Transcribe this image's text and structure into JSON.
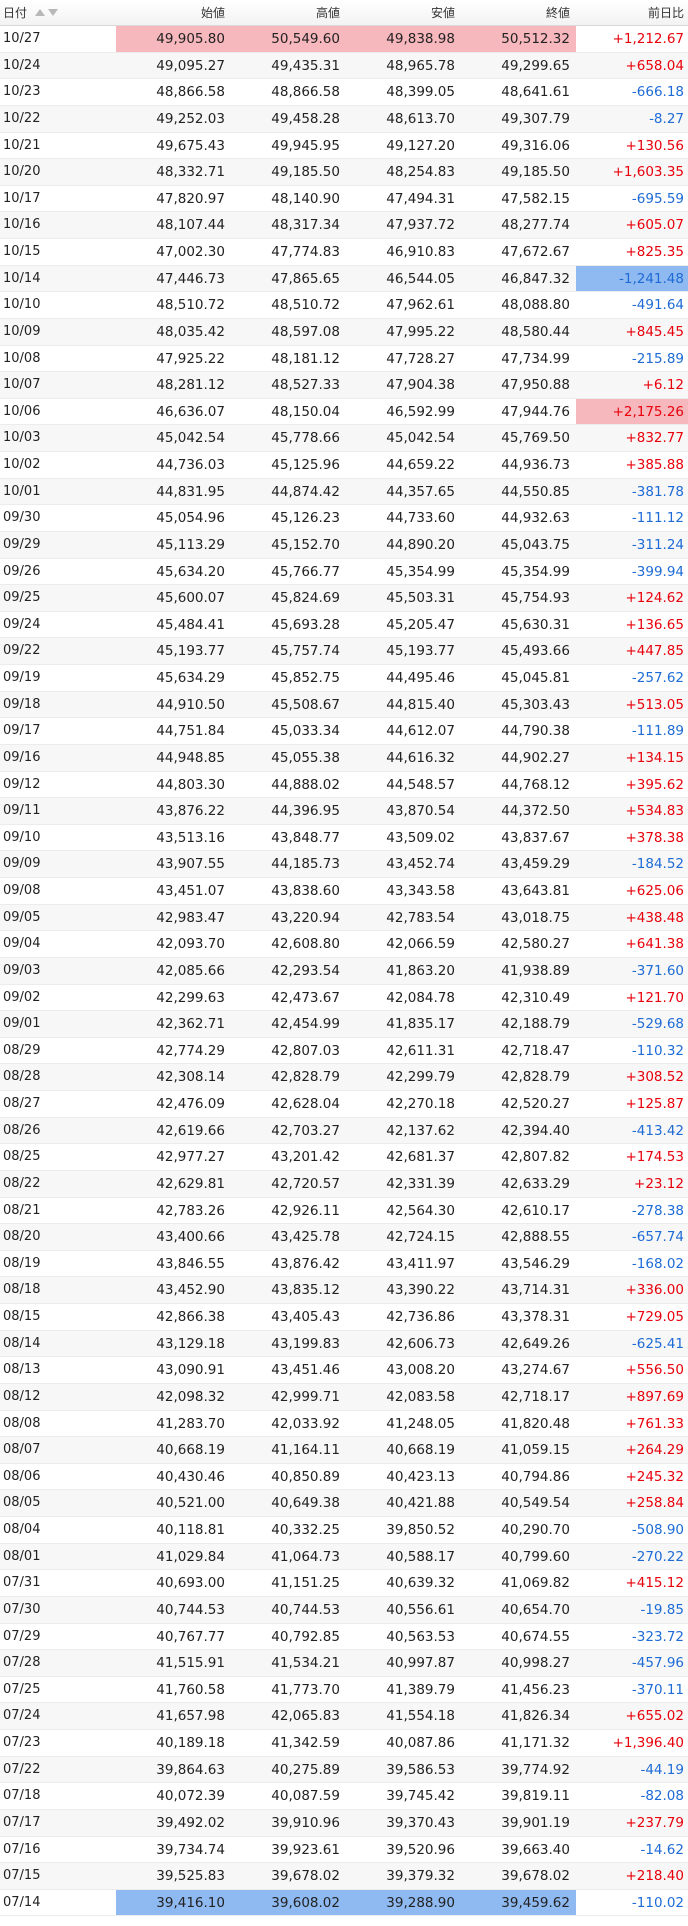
{
  "headers": {
    "date": "日付",
    "open": "始値",
    "high": "高値",
    "low": "安値",
    "close": "終値",
    "change": "前日比"
  },
  "colors": {
    "up": "#e8000b",
    "down": "#1e6bd6",
    "highlight_high": "#f6b7bd",
    "highlight_low": "#8fb9f1"
  },
  "rows": [
    {
      "date": "10/27",
      "open": "49,905.80",
      "high": "50,549.60",
      "low": "49,838.98",
      "close": "50,512.32",
      "change": "+1,212.67",
      "dir": "pos",
      "hl": [
        "open",
        "high",
        "low",
        "close"
      ],
      "hlc": "red"
    },
    {
      "date": "10/24",
      "open": "49,095.27",
      "high": "49,435.31",
      "low": "48,965.78",
      "close": "49,299.65",
      "change": "+658.04",
      "dir": "pos"
    },
    {
      "date": "10/23",
      "open": "48,866.58",
      "high": "48,866.58",
      "low": "48,399.05",
      "close": "48,641.61",
      "change": "-666.18",
      "dir": "neg"
    },
    {
      "date": "10/22",
      "open": "49,252.03",
      "high": "49,458.28",
      "low": "48,613.70",
      "close": "49,307.79",
      "change": "-8.27",
      "dir": "neg"
    },
    {
      "date": "10/21",
      "open": "49,675.43",
      "high": "49,945.95",
      "low": "49,127.20",
      "close": "49,316.06",
      "change": "+130.56",
      "dir": "pos"
    },
    {
      "date": "10/20",
      "open": "48,332.71",
      "high": "49,185.50",
      "low": "48,254.83",
      "close": "49,185.50",
      "change": "+1,603.35",
      "dir": "pos"
    },
    {
      "date": "10/17",
      "open": "47,820.97",
      "high": "48,140.90",
      "low": "47,494.31",
      "close": "47,582.15",
      "change": "-695.59",
      "dir": "neg"
    },
    {
      "date": "10/16",
      "open": "48,107.44",
      "high": "48,317.34",
      "low": "47,937.72",
      "close": "48,277.74",
      "change": "+605.07",
      "dir": "pos"
    },
    {
      "date": "10/15",
      "open": "47,002.30",
      "high": "47,774.83",
      "low": "46,910.83",
      "close": "47,672.67",
      "change": "+825.35",
      "dir": "pos"
    },
    {
      "date": "10/14",
      "open": "47,446.73",
      "high": "47,865.65",
      "low": "46,544.05",
      "close": "46,847.32",
      "change": "-1,241.48",
      "dir": "neg",
      "hl": [
        "change"
      ],
      "hlc": "blue"
    },
    {
      "date": "10/10",
      "open": "48,510.72",
      "high": "48,510.72",
      "low": "47,962.61",
      "close": "48,088.80",
      "change": "-491.64",
      "dir": "neg"
    },
    {
      "date": "10/09",
      "open": "48,035.42",
      "high": "48,597.08",
      "low": "47,995.22",
      "close": "48,580.44",
      "change": "+845.45",
      "dir": "pos"
    },
    {
      "date": "10/08",
      "open": "47,925.22",
      "high": "48,181.12",
      "low": "47,728.27",
      "close": "47,734.99",
      "change": "-215.89",
      "dir": "neg"
    },
    {
      "date": "10/07",
      "open": "48,281.12",
      "high": "48,527.33",
      "low": "47,904.38",
      "close": "47,950.88",
      "change": "+6.12",
      "dir": "pos"
    },
    {
      "date": "10/06",
      "open": "46,636.07",
      "high": "48,150.04",
      "low": "46,592.99",
      "close": "47,944.76",
      "change": "+2,175.26",
      "dir": "pos",
      "hl": [
        "change"
      ],
      "hlc": "red"
    },
    {
      "date": "10/03",
      "open": "45,042.54",
      "high": "45,778.66",
      "low": "45,042.54",
      "close": "45,769.50",
      "change": "+832.77",
      "dir": "pos"
    },
    {
      "date": "10/02",
      "open": "44,736.03",
      "high": "45,125.96",
      "low": "44,659.22",
      "close": "44,936.73",
      "change": "+385.88",
      "dir": "pos"
    },
    {
      "date": "10/01",
      "open": "44,831.95",
      "high": "44,874.42",
      "low": "44,357.65",
      "close": "44,550.85",
      "change": "-381.78",
      "dir": "neg"
    },
    {
      "date": "09/30",
      "open": "45,054.96",
      "high": "45,126.23",
      "low": "44,733.60",
      "close": "44,932.63",
      "change": "-111.12",
      "dir": "neg"
    },
    {
      "date": "09/29",
      "open": "45,113.29",
      "high": "45,152.70",
      "low": "44,890.20",
      "close": "45,043.75",
      "change": "-311.24",
      "dir": "neg"
    },
    {
      "date": "09/26",
      "open": "45,634.20",
      "high": "45,766.77",
      "low": "45,354.99",
      "close": "45,354.99",
      "change": "-399.94",
      "dir": "neg"
    },
    {
      "date": "09/25",
      "open": "45,600.07",
      "high": "45,824.69",
      "low": "45,503.31",
      "close": "45,754.93",
      "change": "+124.62",
      "dir": "pos"
    },
    {
      "date": "09/24",
      "open": "45,484.41",
      "high": "45,693.28",
      "low": "45,205.47",
      "close": "45,630.31",
      "change": "+136.65",
      "dir": "pos"
    },
    {
      "date": "09/22",
      "open": "45,193.77",
      "high": "45,757.74",
      "low": "45,193.77",
      "close": "45,493.66",
      "change": "+447.85",
      "dir": "pos"
    },
    {
      "date": "09/19",
      "open": "45,634.29",
      "high": "45,852.75",
      "low": "44,495.46",
      "close": "45,045.81",
      "change": "-257.62",
      "dir": "neg"
    },
    {
      "date": "09/18",
      "open": "44,910.50",
      "high": "45,508.67",
      "low": "44,815.40",
      "close": "45,303.43",
      "change": "+513.05",
      "dir": "pos"
    },
    {
      "date": "09/17",
      "open": "44,751.84",
      "high": "45,033.34",
      "low": "44,612.07",
      "close": "44,790.38",
      "change": "-111.89",
      "dir": "neg"
    },
    {
      "date": "09/16",
      "open": "44,948.85",
      "high": "45,055.38",
      "low": "44,616.32",
      "close": "44,902.27",
      "change": "+134.15",
      "dir": "pos"
    },
    {
      "date": "09/12",
      "open": "44,803.30",
      "high": "44,888.02",
      "low": "44,548.57",
      "close": "44,768.12",
      "change": "+395.62",
      "dir": "pos"
    },
    {
      "date": "09/11",
      "open": "43,876.22",
      "high": "44,396.95",
      "low": "43,870.54",
      "close": "44,372.50",
      "change": "+534.83",
      "dir": "pos"
    },
    {
      "date": "09/10",
      "open": "43,513.16",
      "high": "43,848.77",
      "low": "43,509.02",
      "close": "43,837.67",
      "change": "+378.38",
      "dir": "pos"
    },
    {
      "date": "09/09",
      "open": "43,907.55",
      "high": "44,185.73",
      "low": "43,452.74",
      "close": "43,459.29",
      "change": "-184.52",
      "dir": "neg"
    },
    {
      "date": "09/08",
      "open": "43,451.07",
      "high": "43,838.60",
      "low": "43,343.58",
      "close": "43,643.81",
      "change": "+625.06",
      "dir": "pos"
    },
    {
      "date": "09/05",
      "open": "42,983.47",
      "high": "43,220.94",
      "low": "42,783.54",
      "close": "43,018.75",
      "change": "+438.48",
      "dir": "pos"
    },
    {
      "date": "09/04",
      "open": "42,093.70",
      "high": "42,608.80",
      "low": "42,066.59",
      "close": "42,580.27",
      "change": "+641.38",
      "dir": "pos"
    },
    {
      "date": "09/03",
      "open": "42,085.66",
      "high": "42,293.54",
      "low": "41,863.20",
      "close": "41,938.89",
      "change": "-371.60",
      "dir": "neg"
    },
    {
      "date": "09/02",
      "open": "42,299.63",
      "high": "42,473.67",
      "low": "42,084.78",
      "close": "42,310.49",
      "change": "+121.70",
      "dir": "pos"
    },
    {
      "date": "09/01",
      "open": "42,362.71",
      "high": "42,454.99",
      "low": "41,835.17",
      "close": "42,188.79",
      "change": "-529.68",
      "dir": "neg"
    },
    {
      "date": "08/29",
      "open": "42,774.29",
      "high": "42,807.03",
      "low": "42,611.31",
      "close": "42,718.47",
      "change": "-110.32",
      "dir": "neg"
    },
    {
      "date": "08/28",
      "open": "42,308.14",
      "high": "42,828.79",
      "low": "42,299.79",
      "close": "42,828.79",
      "change": "+308.52",
      "dir": "pos"
    },
    {
      "date": "08/27",
      "open": "42,476.09",
      "high": "42,628.04",
      "low": "42,270.18",
      "close": "42,520.27",
      "change": "+125.87",
      "dir": "pos"
    },
    {
      "date": "08/26",
      "open": "42,619.66",
      "high": "42,703.27",
      "low": "42,137.62",
      "close": "42,394.40",
      "change": "-413.42",
      "dir": "neg"
    },
    {
      "date": "08/25",
      "open": "42,977.27",
      "high": "43,201.42",
      "low": "42,681.37",
      "close": "42,807.82",
      "change": "+174.53",
      "dir": "pos"
    },
    {
      "date": "08/22",
      "open": "42,629.81",
      "high": "42,720.57",
      "low": "42,331.39",
      "close": "42,633.29",
      "change": "+23.12",
      "dir": "pos"
    },
    {
      "date": "08/21",
      "open": "42,783.26",
      "high": "42,926.11",
      "low": "42,564.30",
      "close": "42,610.17",
      "change": "-278.38",
      "dir": "neg"
    },
    {
      "date": "08/20",
      "open": "43,400.66",
      "high": "43,425.78",
      "low": "42,724.15",
      "close": "42,888.55",
      "change": "-657.74",
      "dir": "neg"
    },
    {
      "date": "08/19",
      "open": "43,846.55",
      "high": "43,876.42",
      "low": "43,411.97",
      "close": "43,546.29",
      "change": "-168.02",
      "dir": "neg"
    },
    {
      "date": "08/18",
      "open": "43,452.90",
      "high": "43,835.12",
      "low": "43,390.22",
      "close": "43,714.31",
      "change": "+336.00",
      "dir": "pos"
    },
    {
      "date": "08/15",
      "open": "42,866.38",
      "high": "43,405.43",
      "low": "42,736.86",
      "close": "43,378.31",
      "change": "+729.05",
      "dir": "pos"
    },
    {
      "date": "08/14",
      "open": "43,129.18",
      "high": "43,199.83",
      "low": "42,606.73",
      "close": "42,649.26",
      "change": "-625.41",
      "dir": "neg"
    },
    {
      "date": "08/13",
      "open": "43,090.91",
      "high": "43,451.46",
      "low": "43,008.20",
      "close": "43,274.67",
      "change": "+556.50",
      "dir": "pos"
    },
    {
      "date": "08/12",
      "open": "42,098.32",
      "high": "42,999.71",
      "low": "42,083.58",
      "close": "42,718.17",
      "change": "+897.69",
      "dir": "pos"
    },
    {
      "date": "08/08",
      "open": "41,283.70",
      "high": "42,033.92",
      "low": "41,248.05",
      "close": "41,820.48",
      "change": "+761.33",
      "dir": "pos"
    },
    {
      "date": "08/07",
      "open": "40,668.19",
      "high": "41,164.11",
      "low": "40,668.19",
      "close": "41,059.15",
      "change": "+264.29",
      "dir": "pos"
    },
    {
      "date": "08/06",
      "open": "40,430.46",
      "high": "40,850.89",
      "low": "40,423.13",
      "close": "40,794.86",
      "change": "+245.32",
      "dir": "pos"
    },
    {
      "date": "08/05",
      "open": "40,521.00",
      "high": "40,649.38",
      "low": "40,421.88",
      "close": "40,549.54",
      "change": "+258.84",
      "dir": "pos"
    },
    {
      "date": "08/04",
      "open": "40,118.81",
      "high": "40,332.25",
      "low": "39,850.52",
      "close": "40,290.70",
      "change": "-508.90",
      "dir": "neg"
    },
    {
      "date": "08/01",
      "open": "41,029.84",
      "high": "41,064.73",
      "low": "40,588.17",
      "close": "40,799.60",
      "change": "-270.22",
      "dir": "neg"
    },
    {
      "date": "07/31",
      "open": "40,693.00",
      "high": "41,151.25",
      "low": "40,639.32",
      "close": "41,069.82",
      "change": "+415.12",
      "dir": "pos"
    },
    {
      "date": "07/30",
      "open": "40,744.53",
      "high": "40,744.53",
      "low": "40,556.61",
      "close": "40,654.70",
      "change": "-19.85",
      "dir": "neg"
    },
    {
      "date": "07/29",
      "open": "40,767.77",
      "high": "40,792.85",
      "low": "40,563.53",
      "close": "40,674.55",
      "change": "-323.72",
      "dir": "neg"
    },
    {
      "date": "07/28",
      "open": "41,515.91",
      "high": "41,534.21",
      "low": "40,997.87",
      "close": "40,998.27",
      "change": "-457.96",
      "dir": "neg"
    },
    {
      "date": "07/25",
      "open": "41,760.58",
      "high": "41,773.70",
      "low": "41,389.79",
      "close": "41,456.23",
      "change": "-370.11",
      "dir": "neg"
    },
    {
      "date": "07/24",
      "open": "41,657.98",
      "high": "42,065.83",
      "low": "41,554.18",
      "close": "41,826.34",
      "change": "+655.02",
      "dir": "pos"
    },
    {
      "date": "07/23",
      "open": "40,189.18",
      "high": "41,342.59",
      "low": "40,087.86",
      "close": "41,171.32",
      "change": "+1,396.40",
      "dir": "pos"
    },
    {
      "date": "07/22",
      "open": "39,864.63",
      "high": "40,275.89",
      "low": "39,586.53",
      "close": "39,774.92",
      "change": "-44.19",
      "dir": "neg"
    },
    {
      "date": "07/18",
      "open": "40,072.39",
      "high": "40,087.59",
      "low": "39,745.42",
      "close": "39,819.11",
      "change": "-82.08",
      "dir": "neg"
    },
    {
      "date": "07/17",
      "open": "39,492.02",
      "high": "39,910.96",
      "low": "39,370.43",
      "close": "39,901.19",
      "change": "+237.79",
      "dir": "pos"
    },
    {
      "date": "07/16",
      "open": "39,734.74",
      "high": "39,923.61",
      "low": "39,520.96",
      "close": "39,663.40",
      "change": "-14.62",
      "dir": "neg"
    },
    {
      "date": "07/15",
      "open": "39,525.83",
      "high": "39,678.02",
      "low": "39,379.32",
      "close": "39,678.02",
      "change": "+218.40",
      "dir": "pos"
    },
    {
      "date": "07/14",
      "open": "39,416.10",
      "high": "39,608.02",
      "low": "39,288.90",
      "close": "39,459.62",
      "change": "-110.02",
      "dir": "neg",
      "hl": [
        "open",
        "high",
        "low",
        "close"
      ],
      "hlc": "blue"
    }
  ]
}
